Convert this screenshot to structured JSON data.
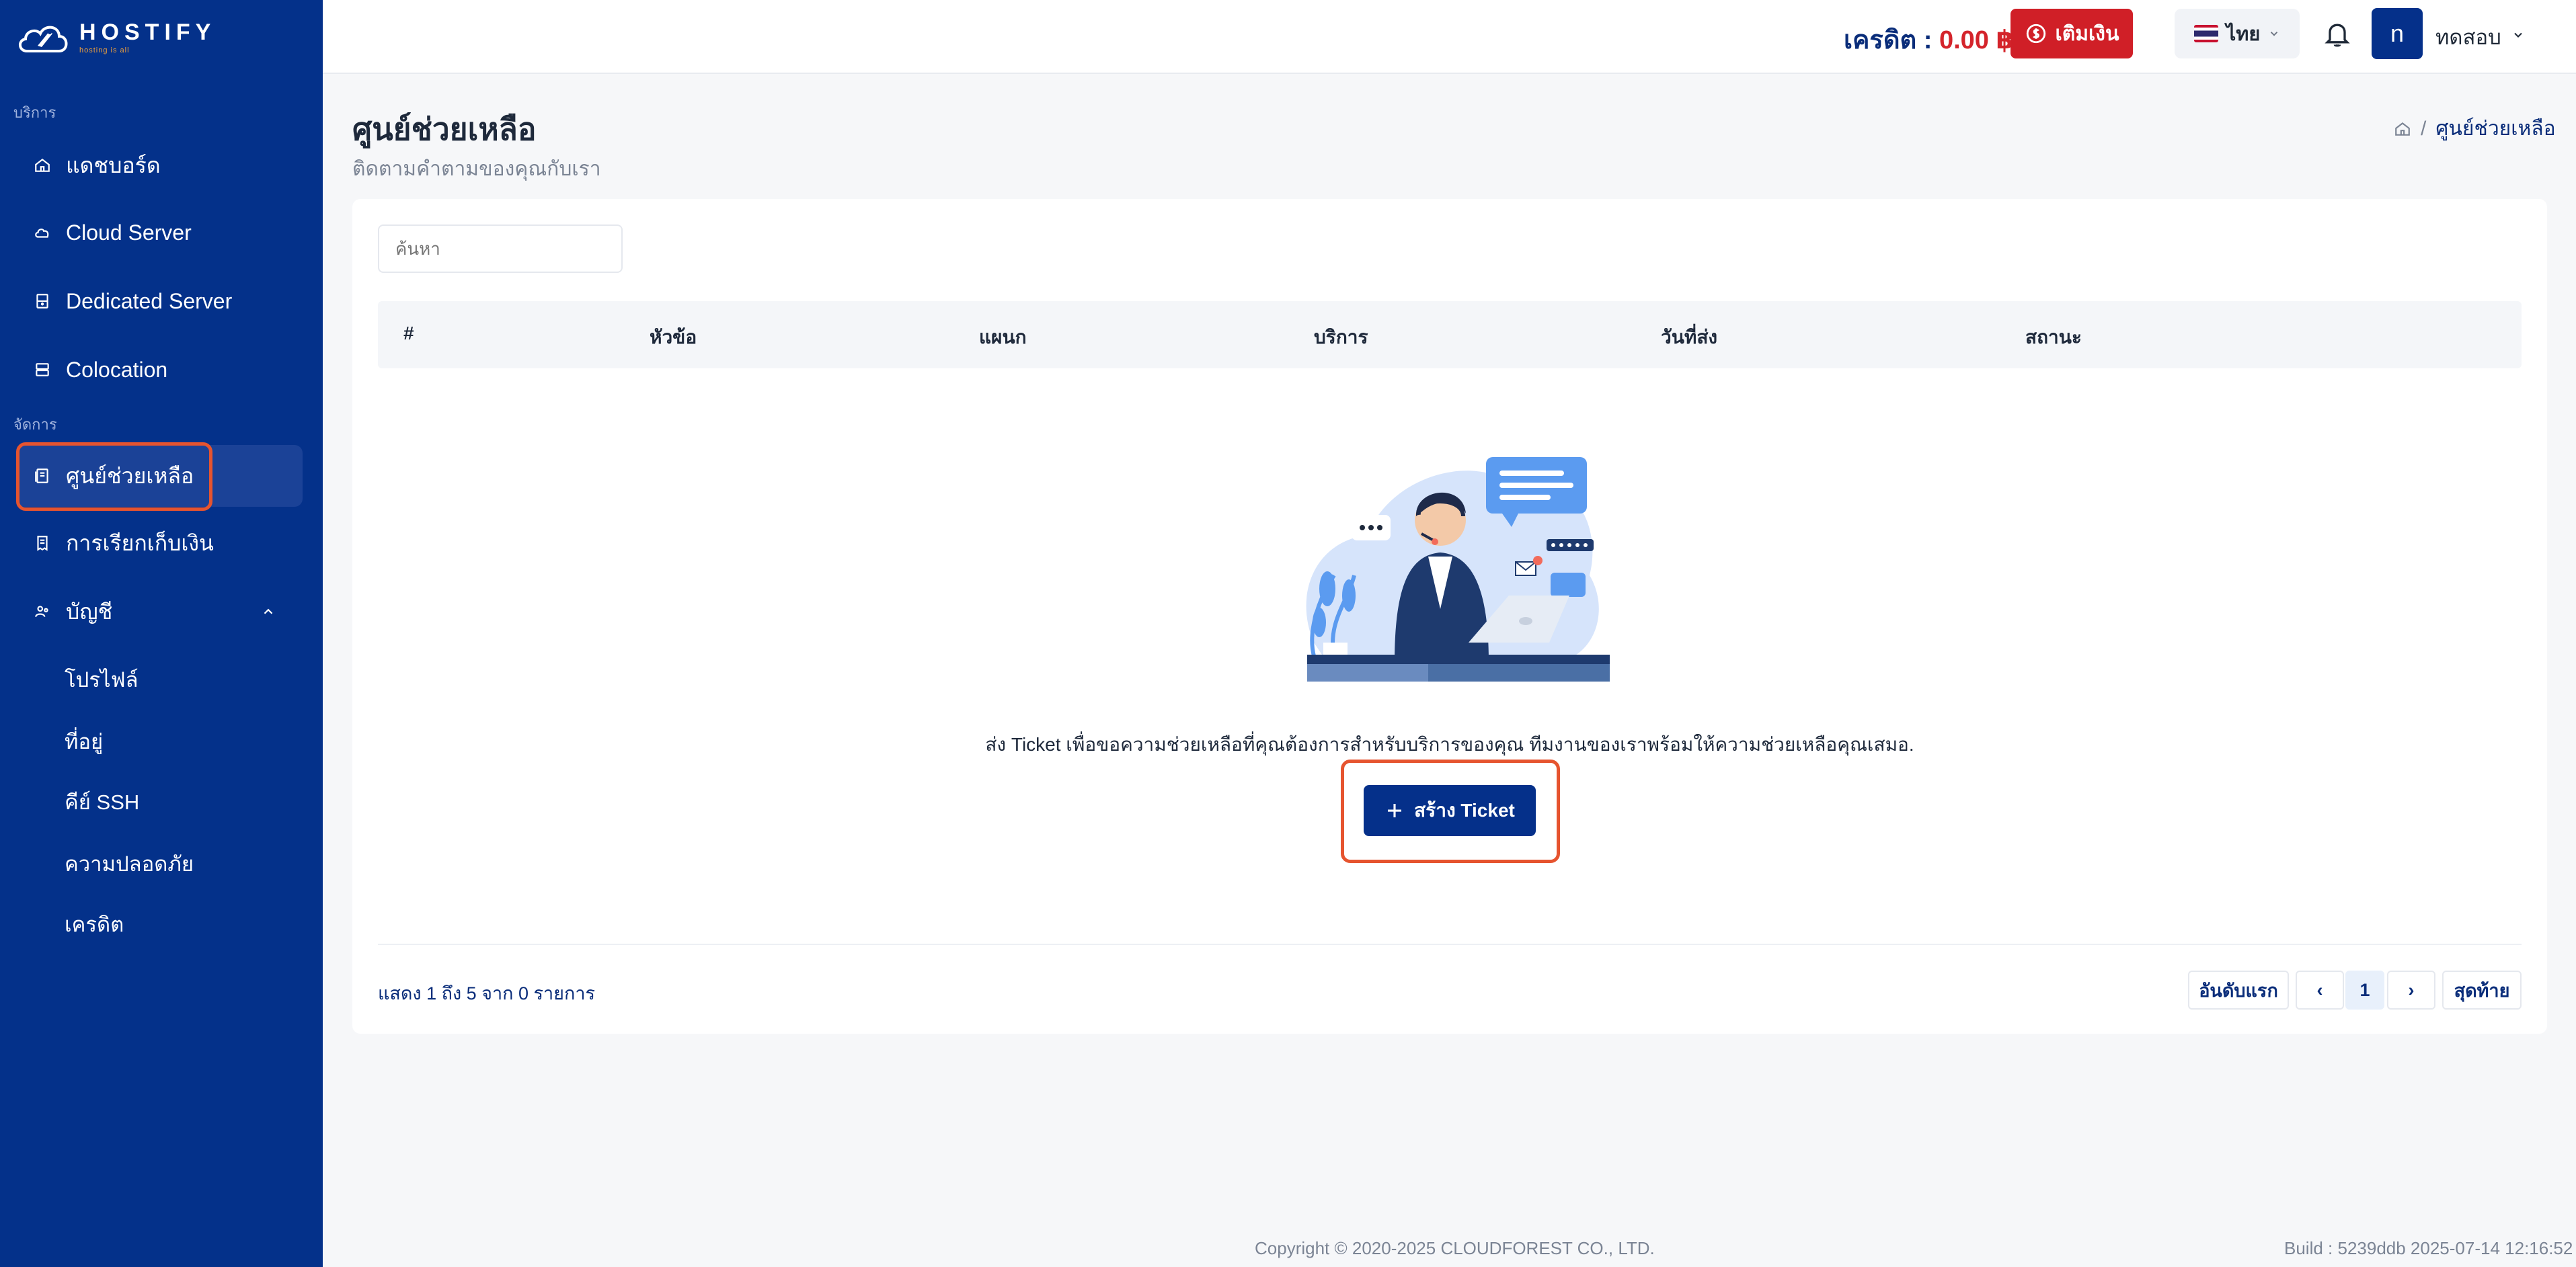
{
  "brand": {
    "name": "HOSTIFY",
    "tagline": "hosting is all"
  },
  "sidebar": {
    "section_services": "บริการ",
    "section_manage": "จัดการ",
    "items": [
      {
        "label": "แดชบอร์ด",
        "icon": "home-icon"
      },
      {
        "label": "Cloud Server",
        "icon": "cloud-icon"
      },
      {
        "label": "Dedicated Server",
        "icon": "server-icon"
      },
      {
        "label": "Colocation",
        "icon": "rack-icon"
      },
      {
        "label": "ศูนย์ช่วยเหลือ",
        "icon": "support-icon",
        "active": true
      },
      {
        "label": "การเรียกเก็บเงิน",
        "icon": "invoice-icon"
      },
      {
        "label": "บัญชี",
        "icon": "users-icon"
      }
    ],
    "account_sub": [
      "โปรไฟล์",
      "ที่อยู่",
      "คีย์ SSH",
      "ความปลอดภัย",
      "เครดิต"
    ]
  },
  "header": {
    "credit_label": "เครดิต :",
    "credit_amount": "0.00 ฿",
    "topup_label": "เติมเงิน",
    "language": "ไทย",
    "avatar_initial": "n",
    "username": "ทดสอบ"
  },
  "page": {
    "title": "ศูนย์ช่วยเหลือ",
    "subtitle": "ติดตามคำตามของคุณกับเรา",
    "breadcrumb_current": "ศูนย์ช่วยเหลือ"
  },
  "table": {
    "search_placeholder": "ค้นหา",
    "columns": [
      "#",
      "หัวข้อ",
      "แผนก",
      "บริการ",
      "วันที่ส่ง",
      "สถานะ"
    ]
  },
  "empty": {
    "message": "ส่ง Ticket เพื่อขอความช่วยเหลือที่คุณต้องการสำหรับบริการของคุณ ทีมงานของเราพร้อมให้ความช่วยเหลือคุณเสมอ.",
    "create_label": "สร้าง Ticket"
  },
  "pagination": {
    "showing": "แสดง 1 ถึง 5 จาก 0 รายการ",
    "first": "อันดับแรก",
    "prev": "‹",
    "current": "1",
    "next": "›",
    "last": "สุดท้าย"
  },
  "footer": {
    "copyright": "Copyright © 2020-2025 CLOUDFOREST CO., LTD.",
    "build": "Build : 5239ddb 2025-07-14 12:16:52"
  },
  "colors": {
    "sidebar": "#04318a",
    "accent": "#05308a",
    "danger": "#d01f27",
    "highlight": "#e6542f"
  }
}
